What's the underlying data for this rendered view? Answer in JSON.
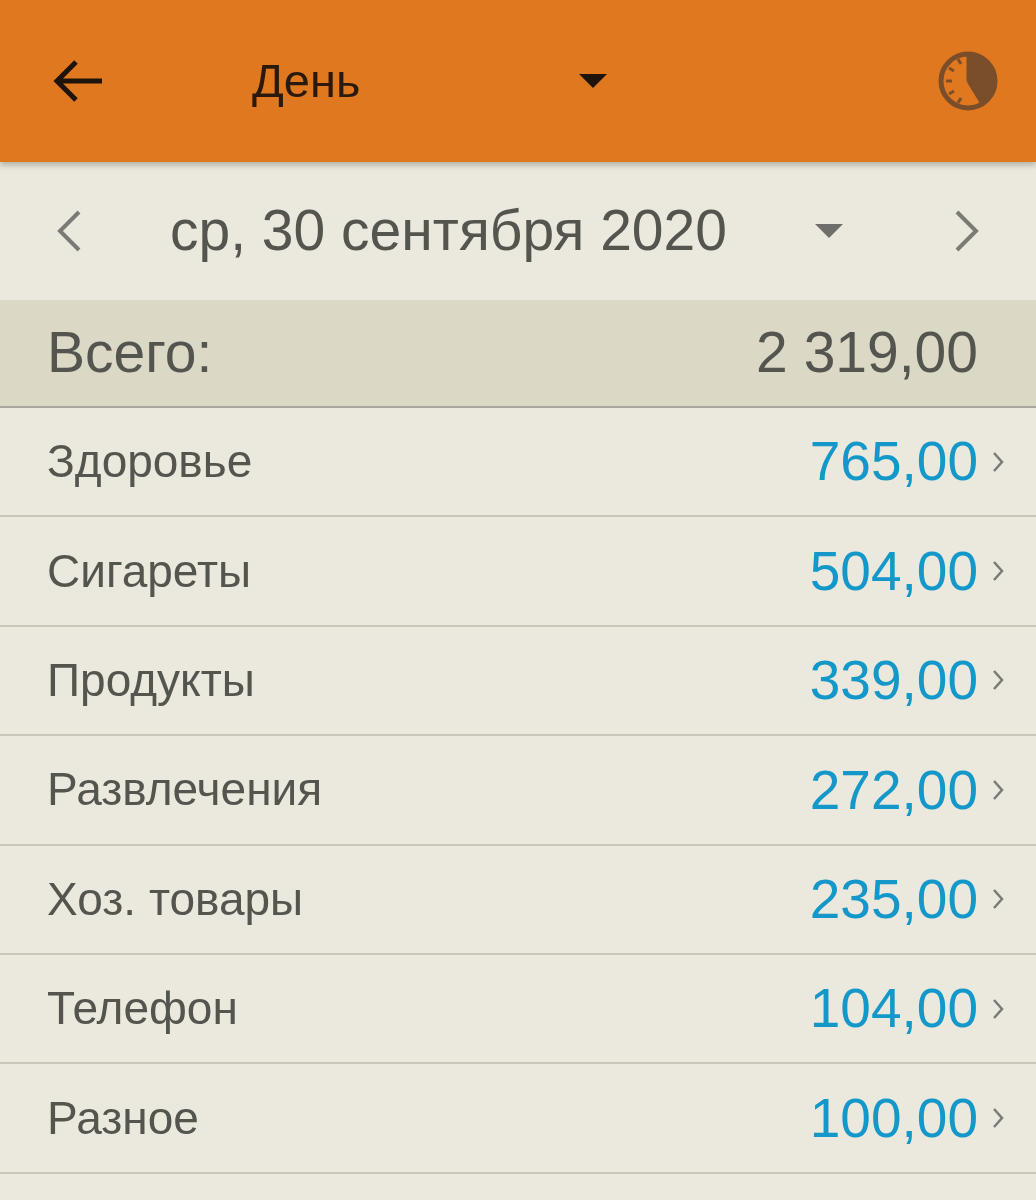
{
  "toolbar": {
    "title": "День"
  },
  "date_bar": {
    "date": "ср, 30 сентября 2020"
  },
  "total": {
    "label": "Всего:",
    "amount": "2 319,00"
  },
  "categories": [
    {
      "name": "Здоровье",
      "amount": "765,00"
    },
    {
      "name": "Сигареты",
      "amount": "504,00"
    },
    {
      "name": "Продукты",
      "amount": "339,00"
    },
    {
      "name": "Развлечения",
      "amount": "272,00"
    },
    {
      "name": "Хоз. товары",
      "amount": "235,00"
    },
    {
      "name": "Телефон",
      "amount": "104,00"
    },
    {
      "name": "Разное",
      "amount": "100,00"
    }
  ]
}
